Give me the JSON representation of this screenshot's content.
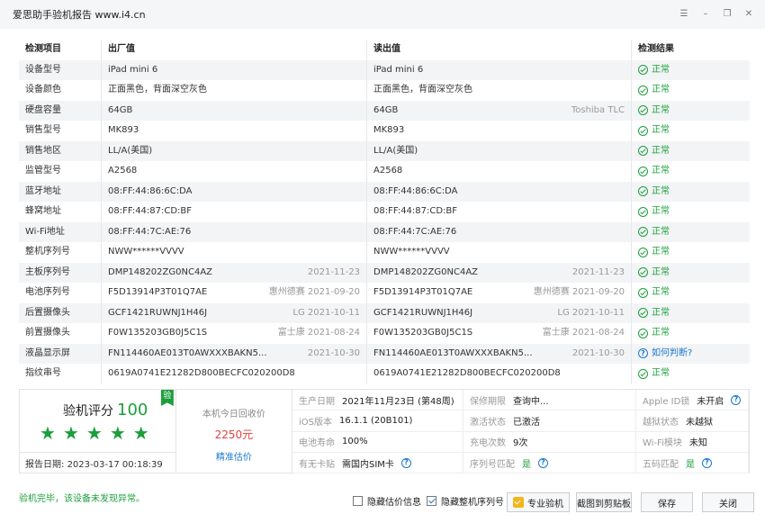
{
  "window": {
    "title": "爱思助手验机报告 www.i4.cn"
  },
  "table": {
    "headers": [
      "检测项目",
      "出厂值",
      "读出值",
      "检测结果"
    ],
    "rows": [
      {
        "item": "设备型号",
        "factory": "iPad mini 6",
        "factory_extra": "",
        "read": "iPad mini 6",
        "read_extra": "",
        "result": "正常",
        "status": "ok"
      },
      {
        "item": "设备颜色",
        "factory": "正面黑色，背面深空灰色",
        "factory_extra": "",
        "read": "正面黑色，背面深空灰色",
        "read_extra": "",
        "result": "正常",
        "status": "ok"
      },
      {
        "item": "硬盘容量",
        "factory": "64GB",
        "factory_extra": "",
        "read": "64GB",
        "read_extra": "Toshiba TLC",
        "result": "正常",
        "status": "ok"
      },
      {
        "item": "销售型号",
        "factory": "MK893",
        "factory_extra": "",
        "read": "MK893",
        "read_extra": "",
        "result": "正常",
        "status": "ok"
      },
      {
        "item": "销售地区",
        "factory": "LL/A(美国)",
        "factory_extra": "",
        "read": "LL/A(美国)",
        "read_extra": "",
        "result": "正常",
        "status": "ok"
      },
      {
        "item": "监管型号",
        "factory": "A2568",
        "factory_extra": "",
        "read": "A2568",
        "read_extra": "",
        "result": "正常",
        "status": "ok"
      },
      {
        "item": "蓝牙地址",
        "factory": "08:FF:44:86:6C:DA",
        "factory_extra": "",
        "read": "08:FF:44:86:6C:DA",
        "read_extra": "",
        "result": "正常",
        "status": "ok"
      },
      {
        "item": "蜂窝地址",
        "factory": "08:FF:44:87:CD:BF",
        "factory_extra": "",
        "read": "08:FF:44:87:CD:BF",
        "read_extra": "",
        "result": "正常",
        "status": "ok"
      },
      {
        "item": "Wi-Fi地址",
        "factory": "08:FF:44:7C:AE:76",
        "factory_extra": "",
        "read": "08:FF:44:7C:AE:76",
        "read_extra": "",
        "result": "正常",
        "status": "ok"
      },
      {
        "item": "整机序列号",
        "factory": "NWW******VVVV",
        "factory_extra": "",
        "read": "NWW******VVVV",
        "read_extra": "",
        "result": "正常",
        "status": "ok"
      },
      {
        "item": "主板序列号",
        "factory": "DMP148202ZG0NC4AZ",
        "factory_extra": "2021-11-23",
        "read": "DMP148202ZG0NC4AZ",
        "read_extra": "2021-11-23",
        "result": "正常",
        "status": "ok"
      },
      {
        "item": "电池序列号",
        "factory": "F5D13914P3T01Q7AE",
        "factory_extra": "惠州德赛 2021-09-20",
        "read": "F5D13914P3T01Q7AE",
        "read_extra": "惠州德赛 2021-09-20",
        "result": "正常",
        "status": "ok"
      },
      {
        "item": "后置摄像头",
        "factory": "GCF1421RUWNJ1H46J",
        "factory_extra": "LG 2021-10-11",
        "read": "GCF1421RUWNJ1H46J",
        "read_extra": "LG 2021-10-11",
        "result": "正常",
        "status": "ok"
      },
      {
        "item": "前置摄像头",
        "factory": "F0W135203GB0J5C1S",
        "factory_extra": "富士康 2021-08-24",
        "read": "F0W135203GB0J5C1S",
        "read_extra": "富士康 2021-08-24",
        "result": "正常",
        "status": "ok"
      },
      {
        "item": "液晶显示屏",
        "factory": "FN114460AE013T0AWXXXBAKN5...",
        "factory_extra": "2021-10-30",
        "read": "FN114460AE013T0AWXXXBAKN5...",
        "read_extra": "2021-10-30",
        "result": "如何判断?",
        "status": "warn"
      },
      {
        "item": "指纹串号",
        "factory": "0619A0741E21282D800BECFC020200D8",
        "factory_extra": "",
        "read": "0619A0741E21282D800BECFC020200D8",
        "read_extra": "",
        "result": "正常",
        "status": "ok"
      }
    ]
  },
  "summary": {
    "score_label": "验机评分",
    "score": "100",
    "badge": "验",
    "stars": 5,
    "report_date_label": "报告日期:",
    "report_date": "2023-03-17 00:18:39",
    "price_label": "本机今日回收价",
    "price": "2250元",
    "price_link": "精准估价",
    "grid": [
      {
        "k": "生产日期",
        "v": "2021年11月23日 (第48周)",
        "type": "text"
      },
      {
        "k": "保修期限",
        "v": "查询中...",
        "type": "text"
      },
      {
        "k": "Apple ID锁",
        "v": "未开启",
        "type": "help"
      },
      {
        "k": "iOS版本",
        "v": "16.1.1 (20B101)",
        "type": "text"
      },
      {
        "k": "激活状态",
        "v": "已激活",
        "type": "text"
      },
      {
        "k": "越狱状态",
        "v": "未越狱",
        "type": "text"
      },
      {
        "k": "电池寿命",
        "v": "100%",
        "type": "text"
      },
      {
        "k": "充电次数",
        "v": "9次",
        "type": "text"
      },
      {
        "k": "Wi-Fi模块",
        "v": "未知",
        "type": "text"
      },
      {
        "k": "有无卡贴",
        "v": "需国内SIM卡",
        "type": "help"
      },
      {
        "k": "序列号匹配",
        "v": "是",
        "type": "green-help"
      },
      {
        "k": "五码匹配",
        "v": "是",
        "type": "green-help"
      }
    ]
  },
  "footer": {
    "message": "验机完毕，该设备未发现异常。",
    "hide_price": "隐藏估价信息",
    "hide_serial": "隐藏整机序列号",
    "pro_check": "专业验机",
    "screenshot": "截图到剪贴板",
    "save": "保存",
    "close": "关闭"
  },
  "colors": {
    "ok": "#1b9f3b",
    "link": "#1a78d0",
    "price": "#e0403c"
  }
}
